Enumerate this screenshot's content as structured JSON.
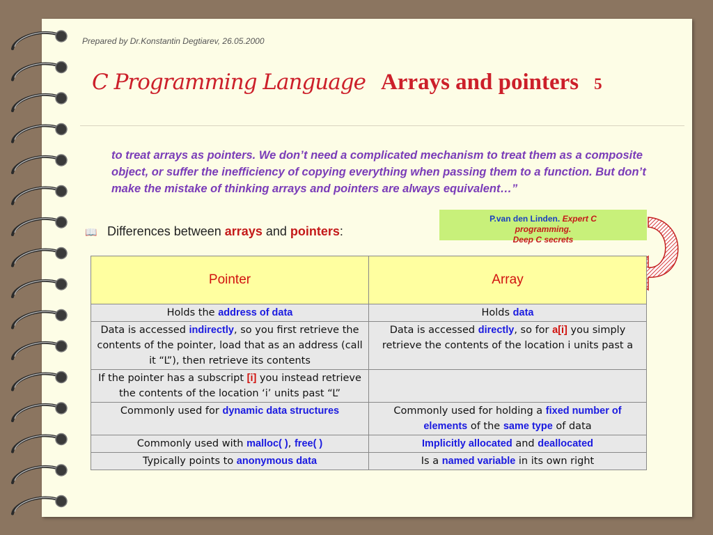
{
  "credit": "Prepared by Dr.Konstantin Degtiarev, 26.05.2000",
  "title": {
    "main": "C Programming Language",
    "sub": "Arrays and pointers",
    "page": "5"
  },
  "quote": "to treat arrays as pointers. We don’t need a complicated mechanism to treat them as a composite object, or suffer the inefficiency of copying everything when passing them to a function. But don’t make the mistake of thinking arrays and pointers are always equivalent…”",
  "bullet": {
    "pre": "Differences between ",
    "w1": "arrays",
    "mid": " and ",
    "w2": "pointers",
    "post": ":"
  },
  "source": {
    "author": "P.van den Linden.",
    "book1": "Expert C",
    "book2": "programming.",
    "book3": "Deep C secrets"
  },
  "table": {
    "headers": [
      "Pointer",
      "Array"
    ],
    "rows": [
      {
        "left": [
          [
            "Holds the ",
            ""
          ],
          [
            "address of data",
            "blue"
          ]
        ],
        "right": [
          [
            "Holds ",
            ""
          ],
          [
            "data",
            "blue"
          ]
        ]
      },
      {
        "left": [
          [
            "Data is accessed ",
            ""
          ],
          [
            "indirectly",
            "blue"
          ],
          [
            ", so you first retrieve the contents of the pointer, load that as an address (call it “L”), then retrieve its contents",
            ""
          ]
        ],
        "right": [
          [
            "Data is accessed ",
            ""
          ],
          [
            "directly",
            "blue"
          ],
          [
            ", so for ",
            ""
          ],
          [
            "a[i]",
            "red"
          ],
          [
            " you simply retrieve the contents of the location i units past a",
            ""
          ]
        ]
      },
      {
        "left": [
          [
            "If the pointer has a subscript ",
            ""
          ],
          [
            "[i]",
            "red"
          ],
          [
            " you instead retrieve the contents of the location ‘i’ units past “L”",
            ""
          ]
        ],
        "right": []
      },
      {
        "left": [
          [
            "Commonly used for ",
            ""
          ],
          [
            "dynamic data structures",
            "blue"
          ]
        ],
        "right": [
          [
            "Commonly used for holding a ",
            ""
          ],
          [
            "fixed number of elements",
            "blue"
          ],
          [
            " of the ",
            ""
          ],
          [
            "same type",
            "blue"
          ],
          [
            " of data",
            ""
          ]
        ]
      },
      {
        "left": [
          [
            "Commonly used with ",
            ""
          ],
          [
            "malloc( )",
            "blue"
          ],
          [
            ", ",
            ""
          ],
          [
            "free( )",
            "blue"
          ]
        ],
        "right": [
          [
            "Implicitly allocated",
            "blue"
          ],
          [
            " and ",
            ""
          ],
          [
            "deallocated",
            "blue"
          ]
        ]
      },
      {
        "left": [
          [
            "Typically points to ",
            ""
          ],
          [
            "anonymous data",
            "blue"
          ]
        ],
        "right": [
          [
            "Is a ",
            ""
          ],
          [
            "named variable",
            "blue"
          ],
          [
            " in its own right",
            ""
          ]
        ]
      }
    ]
  },
  "colors": {
    "page": "#fdfde6",
    "accent_red": "#cc1f2a",
    "quote_purple": "#7a3cb8",
    "header_yellow": "#ffffa0",
    "source_green": "#c8f07a",
    "link_blue": "#1a1ae0"
  }
}
